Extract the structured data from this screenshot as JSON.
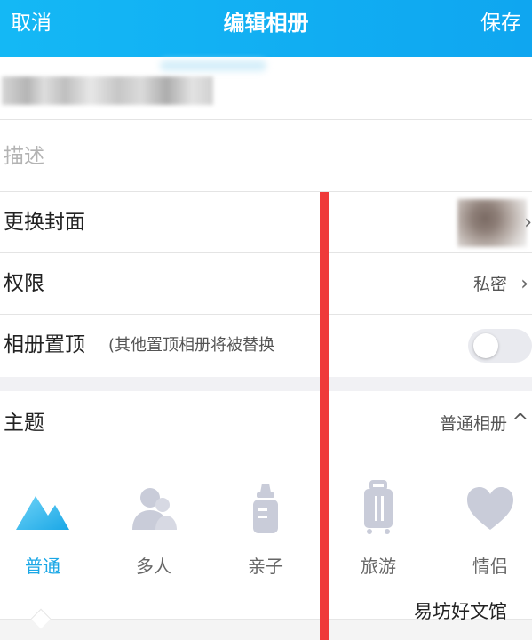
{
  "header": {
    "cancel": "取消",
    "title": "编辑相册",
    "save": "保存",
    "color": "#14b8f5"
  },
  "description": {
    "placeholder": "描述"
  },
  "cover": {
    "label": "更换封面"
  },
  "permission": {
    "label": "权限",
    "value": "私密"
  },
  "pin": {
    "label": "相册置顶",
    "sublabel": "(其他置顶相册将被替换",
    "enabled": false
  },
  "theme": {
    "label": "主题",
    "value": "普通相册",
    "options": [
      {
        "name": "普通",
        "icon": "mountain-icon",
        "active": true
      },
      {
        "name": "多人",
        "icon": "people-icon",
        "active": false
      },
      {
        "name": "亲子",
        "icon": "baby-bottle-icon",
        "active": false
      },
      {
        "name": "旅游",
        "icon": "suitcase-icon",
        "active": false
      },
      {
        "name": "情侣",
        "icon": "heart-icon",
        "active": false
      }
    ]
  },
  "watermark": "易坊好文馆",
  "colors": {
    "accent": "#1aa7e6",
    "inactive_icon": "#c9ccd9",
    "overlay_line": "#ef3a3a"
  }
}
